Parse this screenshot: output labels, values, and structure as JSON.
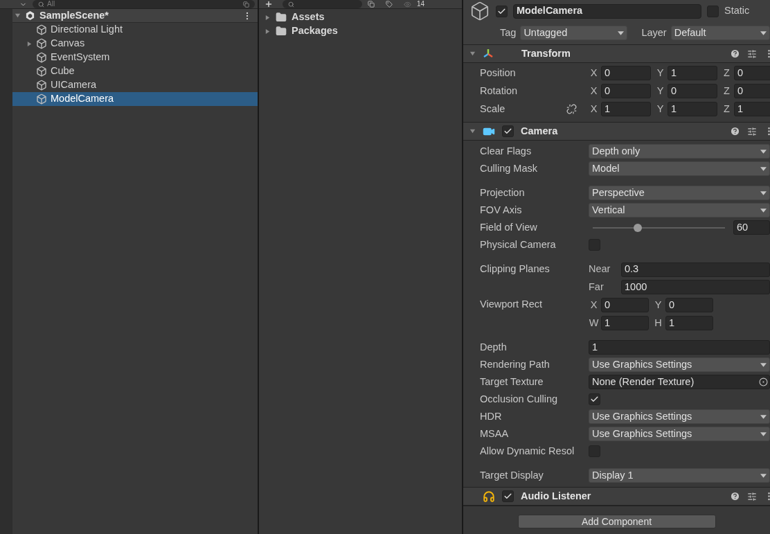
{
  "hierarchy": {
    "search": {
      "placeholder": "All"
    },
    "scene": {
      "name": "SampleScene*",
      "expanded": true
    },
    "items": [
      {
        "label": "Directional Light",
        "has_children": false,
        "selected": false
      },
      {
        "label": "Canvas",
        "has_children": true,
        "selected": false
      },
      {
        "label": "EventSystem",
        "has_children": false,
        "selected": false
      },
      {
        "label": "Cube",
        "has_children": false,
        "selected": false
      },
      {
        "label": "UICamera",
        "has_children": false,
        "selected": false
      },
      {
        "label": "ModelCamera",
        "has_children": false,
        "selected": true
      }
    ]
  },
  "project": {
    "hidden_count": "14",
    "folders": [
      {
        "label": "Assets",
        "expanded": false
      },
      {
        "label": "Packages",
        "expanded": false
      }
    ]
  },
  "inspector": {
    "active": true,
    "name": "ModelCamera",
    "static": false,
    "static_label": "Static",
    "tag_label": "Tag",
    "tag": "Untagged",
    "layer_label": "Layer",
    "layer": "Default",
    "components": [
      {
        "kind": "transform",
        "title": "Transform",
        "expanded": true,
        "rows": [
          {
            "label": "Position",
            "link_toggle": false,
            "axes": [
              {
                "axis": "X",
                "value": "0"
              },
              {
                "axis": "Y",
                "value": "1"
              },
              {
                "axis": "Z",
                "value": "0"
              }
            ]
          },
          {
            "label": "Rotation",
            "link_toggle": false,
            "axes": [
              {
                "axis": "X",
                "value": "0"
              },
              {
                "axis": "Y",
                "value": "0"
              },
              {
                "axis": "Z",
                "value": "0"
              }
            ]
          },
          {
            "label": "Scale",
            "link_toggle": true,
            "axes": [
              {
                "axis": "X",
                "value": "1"
              },
              {
                "axis": "Y",
                "value": "1"
              },
              {
                "axis": "Z",
                "value": "1"
              }
            ]
          }
        ]
      },
      {
        "kind": "camera",
        "title": "Camera",
        "enabled": true,
        "expanded": true,
        "fields": [
          {
            "kind": "dropdown",
            "label": "Clear Flags",
            "value": "Depth only"
          },
          {
            "kind": "dropdown",
            "label": "Culling Mask",
            "value": "Model"
          },
          {
            "kind": "spacer"
          },
          {
            "kind": "dropdown",
            "label": "Projection",
            "value": "Perspective"
          },
          {
            "kind": "dropdown",
            "label": "FOV Axis",
            "value": "Vertical"
          },
          {
            "kind": "slider",
            "label": "Field of View",
            "level": 0.34,
            "value": "60"
          },
          {
            "kind": "checkbox",
            "label": "Physical Camera",
            "checked": false
          },
          {
            "kind": "spacer"
          },
          {
            "kind": "planes",
            "label": "Clipping Planes",
            "near_label": "Near",
            "near": "0.3",
            "far_label": "Far",
            "far": "1000"
          },
          {
            "kind": "rect",
            "label": "Viewport Rect",
            "axes": [
              {
                "axis": "X",
                "value": "0"
              },
              {
                "axis": "Y",
                "value": "0"
              },
              {
                "axis": "W",
                "value": "1"
              },
              {
                "axis": "H",
                "value": "1"
              }
            ]
          },
          {
            "kind": "spacer"
          },
          {
            "kind": "text",
            "label": "Depth",
            "value": "1"
          },
          {
            "kind": "dropdown",
            "label": "Rendering Path",
            "value": "Use Graphics Settings"
          },
          {
            "kind": "object",
            "label": "Target Texture",
            "value": "None (Render Texture)"
          },
          {
            "kind": "checkbox",
            "label": "Occlusion Culling",
            "checked": true
          },
          {
            "kind": "dropdown",
            "label": "HDR",
            "value": "Use Graphics Settings"
          },
          {
            "kind": "dropdown",
            "label": "MSAA",
            "value": "Use Graphics Settings"
          },
          {
            "kind": "checkbox",
            "label": "Allow Dynamic Resol",
            "checked": false
          },
          {
            "kind": "spacer"
          },
          {
            "kind": "dropdown",
            "label": "Target Display",
            "value": "Display 1"
          }
        ]
      },
      {
        "kind": "audio_listener",
        "title": "Audio Listener",
        "enabled": true
      }
    ],
    "add_button": "Add Component"
  }
}
